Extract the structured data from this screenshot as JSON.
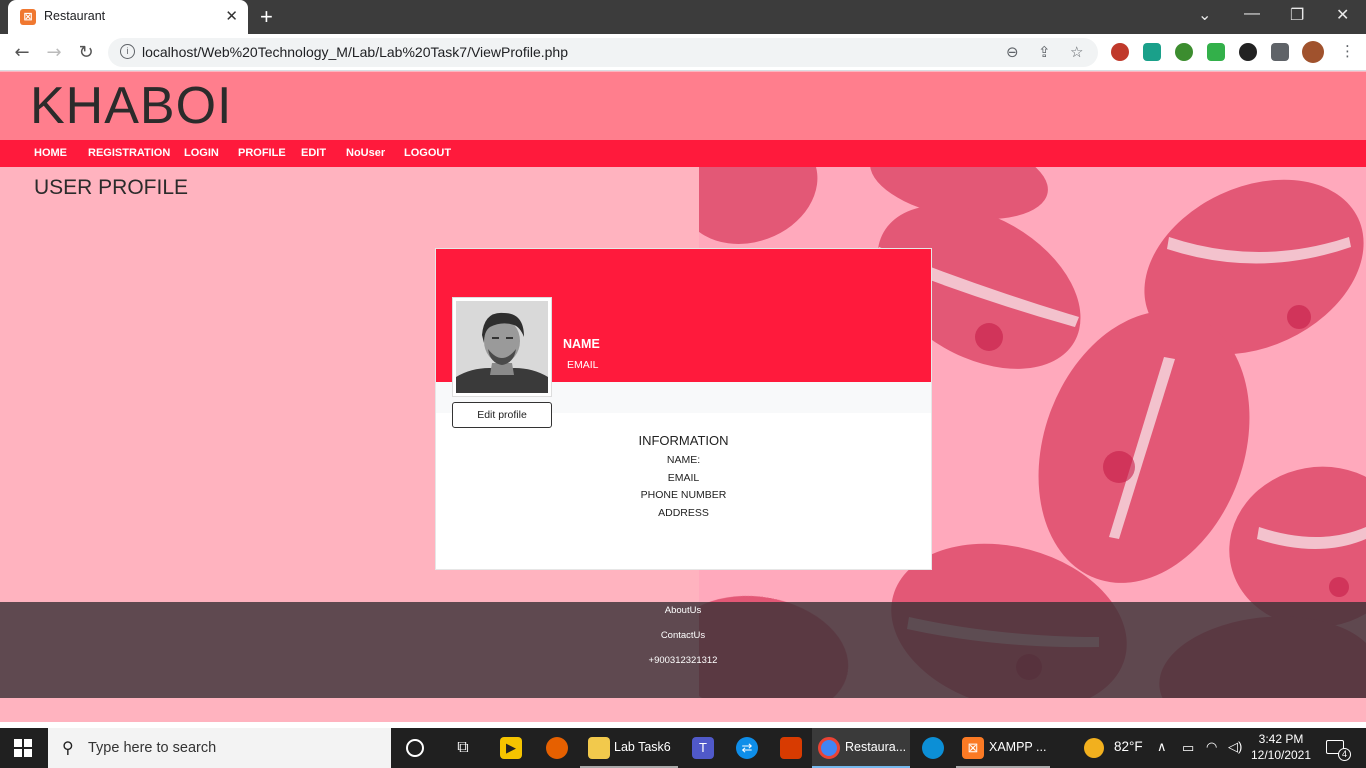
{
  "browser": {
    "tab_title": "Restaurant",
    "url": "localhost/Web%20Technology_M/Lab/Lab%20Task7/ViewProfile.php"
  },
  "site": {
    "logo": "KHABOI",
    "nav": [
      "HOME",
      "REGISTRATION",
      "LOGIN",
      "PROFILE",
      "EDIT",
      "NoUser",
      "LOGOUT"
    ],
    "page_title": "USER PROFILE"
  },
  "profile": {
    "name_label": "NAME",
    "email_label": "EMAIL",
    "edit_button": "Edit profile",
    "info_title": "INFORMATION",
    "info_lines": [
      "NAME:",
      "EMAIL",
      "PHONE NUMBER",
      "ADDRESS"
    ]
  },
  "footer": {
    "links": [
      "AboutUs",
      "ContactUs",
      "+900312321312"
    ]
  },
  "taskbar": {
    "search_placeholder": "Type here to search",
    "apps": [
      "Lab Task6",
      "Restaura...",
      "XAMPP ..."
    ],
    "weather": "82°F",
    "time": "3:42 PM",
    "date": "12/10/2021",
    "notifications": "4"
  },
  "colors": {
    "header": "#ff7e8d",
    "menu": "#ff1a3c",
    "page_bg": "#ffb3bf"
  }
}
